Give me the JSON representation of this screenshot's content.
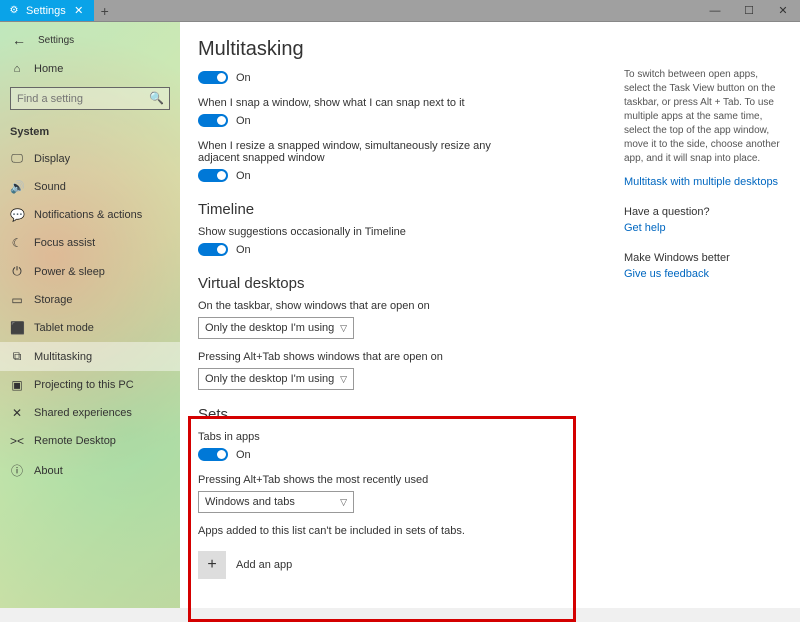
{
  "titlebar": {
    "tab_label": "Settings",
    "minimize_glyph": "—",
    "maximize_glyph": "☐",
    "close_glyph": "✕"
  },
  "sidebar": {
    "back_glyph": "←",
    "title": "Settings",
    "home_label": "Home",
    "search_placeholder": "Find a setting",
    "section": "System",
    "items": [
      {
        "icon": "🖵",
        "label": "Display"
      },
      {
        "icon": "🔊",
        "label": "Sound"
      },
      {
        "icon": "💬",
        "label": "Notifications & actions"
      },
      {
        "icon": "☾",
        "label": "Focus assist"
      },
      {
        "icon": "⏻",
        "label": "Power & sleep"
      },
      {
        "icon": "▭",
        "label": "Storage"
      },
      {
        "icon": "⬛",
        "label": "Tablet mode"
      },
      {
        "icon": "⧉",
        "label": "Multitasking"
      },
      {
        "icon": "▣",
        "label": "Projecting to this PC"
      },
      {
        "icon": "✕",
        "label": "Shared experiences"
      },
      {
        "icon": "><",
        "label": "Remote Desktop"
      },
      {
        "icon": "ⓘ",
        "label": "About"
      }
    ]
  },
  "main": {
    "title": "Multitasking",
    "snap_on": "On",
    "snap_next_desc": "When I snap a window, show what I can snap next to it",
    "snap_next_on": "On",
    "snap_resize_desc": "When I resize a snapped window, simultaneously resize any adjacent snapped window",
    "snap_resize_on": "On",
    "timeline_heading": "Timeline",
    "timeline_desc": "Show suggestions occasionally in Timeline",
    "timeline_on": "On",
    "vd_heading": "Virtual desktops",
    "vd_taskbar_desc": "On the taskbar, show windows that are open on",
    "vd_taskbar_value": "Only the desktop I'm using",
    "vd_alttab_desc": "Pressing Alt+Tab shows windows that are open on",
    "vd_alttab_value": "Only the desktop I'm using",
    "sets_heading": "Sets",
    "sets_tabs_desc": "Tabs in apps",
    "sets_tabs_on": "On",
    "sets_alttab_desc": "Pressing Alt+Tab shows the most recently used",
    "sets_alttab_value": "Windows and tabs",
    "sets_note": "Apps added to this list can't be included in sets of tabs.",
    "add_app_label": "Add an app"
  },
  "aside": {
    "tip_text": "To switch between open apps, select the Task View button on the taskbar, or press Alt + Tab. To use multiple apps at the same time, select the top of the app window, move it to the side, choose another app, and it will snap into place.",
    "tip_link": "Multitask with multiple desktops",
    "question_head": "Have a question?",
    "question_link": "Get help",
    "better_head": "Make Windows better",
    "better_link": "Give us feedback"
  }
}
